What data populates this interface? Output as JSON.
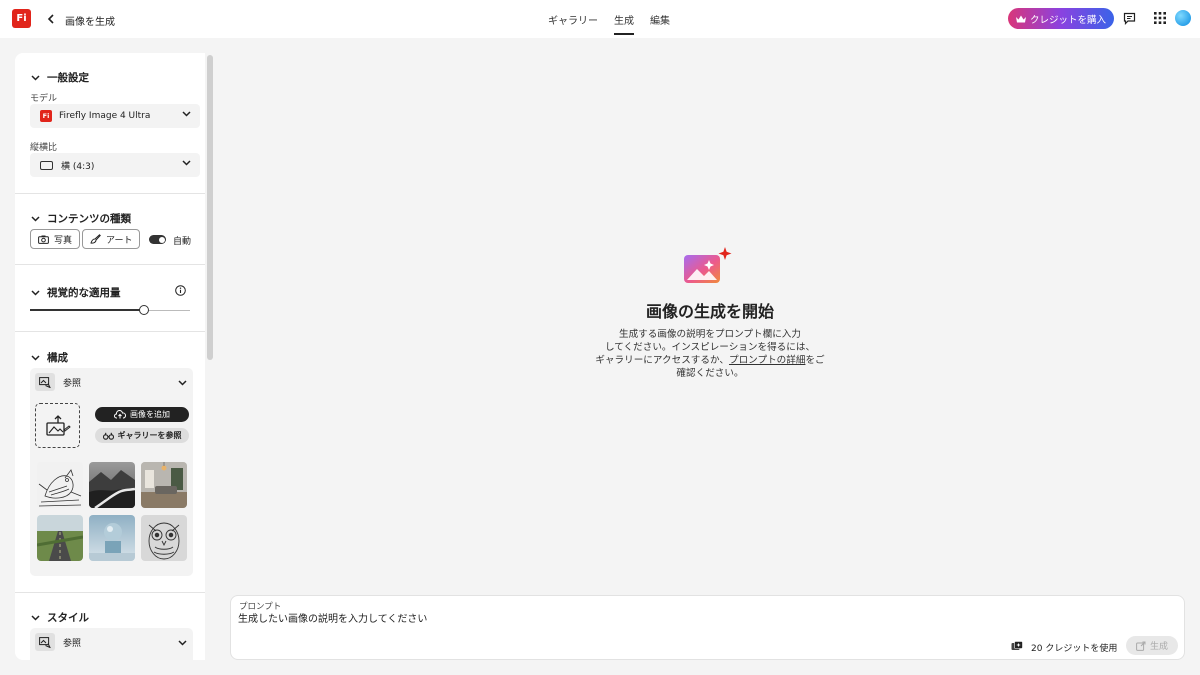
{
  "app": {
    "logo_text": "Fi",
    "page_title": "画像を生成"
  },
  "nav": {
    "tabs": [
      {
        "label": "ギャラリー"
      },
      {
        "label": "生成"
      },
      {
        "label": "編集"
      }
    ]
  },
  "header": {
    "buy_credits_label": "クレジットを購入"
  },
  "panel": {
    "general": {
      "title": "一般設定",
      "model_label": "モデル",
      "model_value": "Firefly Image 4 Ultra",
      "aspect_label": "縦横比",
      "aspect_value": "横 (4:3)"
    },
    "content_type": {
      "title": "コンテンツの種類",
      "photo_label": "写真",
      "art_label": "アート",
      "auto_label": "自動",
      "auto_enabled": true
    },
    "visual_intensity": {
      "title": "視覚的な適用量",
      "value": 0.7
    },
    "composition": {
      "title": "構成",
      "reference_label": "参照",
      "add_image_label": "画像を追加",
      "browse_gallery_label": "ギャラリーを参照"
    },
    "style": {
      "title": "スタイル",
      "reference_label": "参照"
    }
  },
  "main": {
    "title": "画像の生成を開始",
    "desc_line1": "生成する画像の説明をプロンプト欄に入力",
    "desc_line2": "してください。インスピレーションを得るには、",
    "desc_line3_pre": "ギャラリーにアクセスするか、",
    "desc_link": "プロンプトの詳細",
    "desc_line3_post": "をご",
    "desc_line4": "確認ください。"
  },
  "prompt": {
    "label": "プロンプト",
    "placeholder": "生成したい画像の説明を入力してください",
    "credits_text": "20 クレジットを使用",
    "generate_label": "生成"
  },
  "colors": {
    "accent_red": "#e1251b",
    "buy_gradient": [
      "#d9367a",
      "#8a42e0",
      "#3a63e8"
    ]
  }
}
